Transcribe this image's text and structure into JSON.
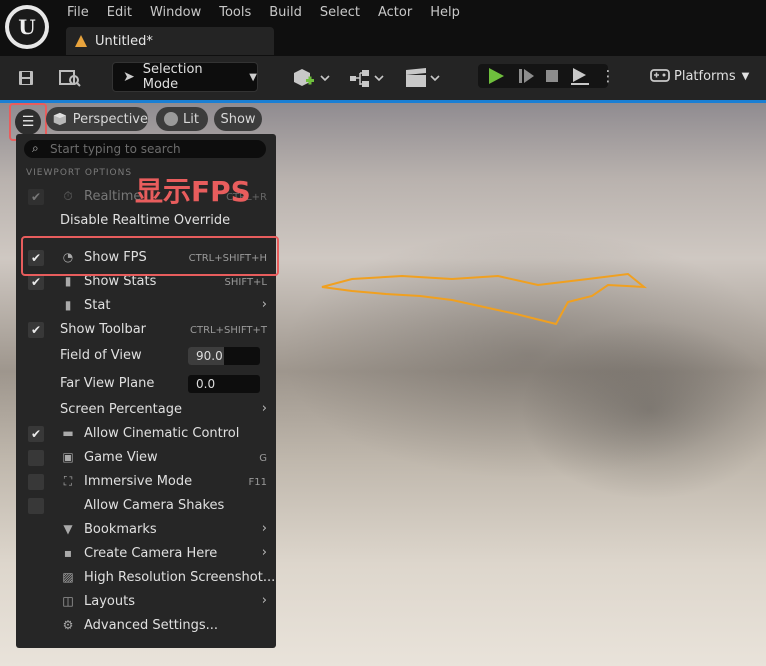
{
  "menubar": {
    "items": [
      "File",
      "Edit",
      "Window",
      "Tools",
      "Build",
      "Select",
      "Actor",
      "Help"
    ]
  },
  "tab": {
    "title": "Untitled*"
  },
  "toolbar": {
    "selection_mode": "Selection Mode",
    "platforms": "Platforms"
  },
  "viewport": {
    "perspective": "Perspective",
    "lit": "Lit",
    "show": "Show"
  },
  "annotation": {
    "label": "显示FPS",
    "color": "#e85d5d"
  },
  "menu": {
    "search_placeholder": "Start typing to search",
    "section": "VIEWPORT OPTIONS",
    "realtime": {
      "label": "Realtime",
      "shortcut": "CTRL+R",
      "checked": true
    },
    "disable_realtime_override": "Disable Realtime Override",
    "show_fps": {
      "label": "Show FPS",
      "shortcut": "CTRL+SHIFT+H",
      "checked": true
    },
    "show_stats": {
      "label": "Show Stats",
      "shortcut": "SHIFT+L",
      "checked": true
    },
    "stat": {
      "label": "Stat"
    },
    "show_toolbar": {
      "label": "Show Toolbar",
      "shortcut": "CTRL+SHIFT+T",
      "checked": true
    },
    "field_of_view": {
      "label": "Field of View",
      "value": "90.0",
      "level": 0.5
    },
    "far_view_plane": {
      "label": "Far View Plane",
      "value": "0.0"
    },
    "screen_percentage": {
      "label": "Screen Percentage"
    },
    "allow_cinematic_control": {
      "label": "Allow Cinematic Control",
      "checked": true
    },
    "game_view": {
      "label": "Game View",
      "shortcut": "G",
      "checked": false
    },
    "immersive_mode": {
      "label": "Immersive Mode",
      "shortcut": "F11",
      "checked": false
    },
    "allow_camera_shakes": {
      "label": "Allow Camera Shakes",
      "checked": false
    },
    "bookmarks": {
      "label": "Bookmarks"
    },
    "create_camera_here": {
      "label": "Create Camera Here"
    },
    "high_res_screenshot": {
      "label": "High Resolution Screenshot..."
    },
    "layouts": {
      "label": "Layouts"
    },
    "advanced_settings": {
      "label": "Advanced Settings..."
    }
  },
  "colors": {
    "accent_play": "#6fbf3d",
    "highlight": "#e85d5d",
    "selection_outline": "#f0a020"
  }
}
